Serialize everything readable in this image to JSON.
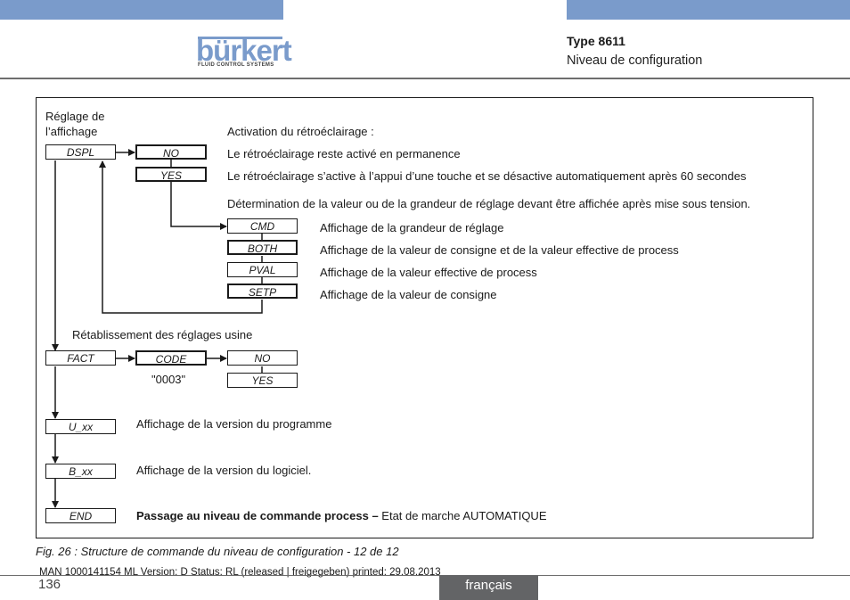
{
  "header": {
    "logo": {
      "word": "bürkert",
      "tagline": "FLUID CONTROL SYSTEMS"
    },
    "type_title": "Type 8611",
    "section": "Niveau de configuration",
    "brand_color": "#7a9bcb"
  },
  "diagram": {
    "dspl_section_label_line1": "Réglage de",
    "dspl_section_label_line2": "l’affichage",
    "nodes": {
      "dspl": "DSPL",
      "no1": "NO",
      "yes1": "YES",
      "cmd": "CMD",
      "both": "BOTH",
      "pval": "PVAL",
      "setp": "SETP",
      "fact": "FACT",
      "code": "CODE",
      "code_value": "\"0003\"",
      "no2": "NO",
      "yes2": "YES",
      "u_xx": "U_xx",
      "b_xx": "B_xx",
      "end": "END"
    },
    "texts": {
      "backlight_title": "Activation du rétroéclairage :",
      "backlight_no": "Le rétroéclairage reste activé en permanence",
      "backlight_yes": "Le rétroéclairage s’active à l’appui d’une touche et se désactive automatiquement après 60 secondes",
      "display_title": "Détermination de la valeur ou de la grandeur de réglage devant être affichée après mise sous tension.",
      "cmd_desc": "Affichage de la grandeur de réglage",
      "both_desc": "Affichage de la valeur de consigne et de la valeur effective de process",
      "pval_desc": "Affichage de la valeur effective de process",
      "setp_desc": "Affichage de la valeur de consigne",
      "fact_title": "Rétablissement des réglages usine",
      "u_desc": "Affichage de la version du programme",
      "b_desc": "Affichage de la version du logiciel.",
      "end_desc_bold": "Passage au niveau de commande process –",
      "end_desc_rest": " Etat de marche AUTOMATIQUE"
    }
  },
  "caption": "Fig. 26 :  Structure de commande du niveau de configuration - 12 de 12",
  "footer": {
    "man_line": "MAN  1000141154  ML  Version: D Status: RL (released | freigegeben)  printed: 29.08.2013",
    "page_number": "136",
    "language": "français"
  }
}
